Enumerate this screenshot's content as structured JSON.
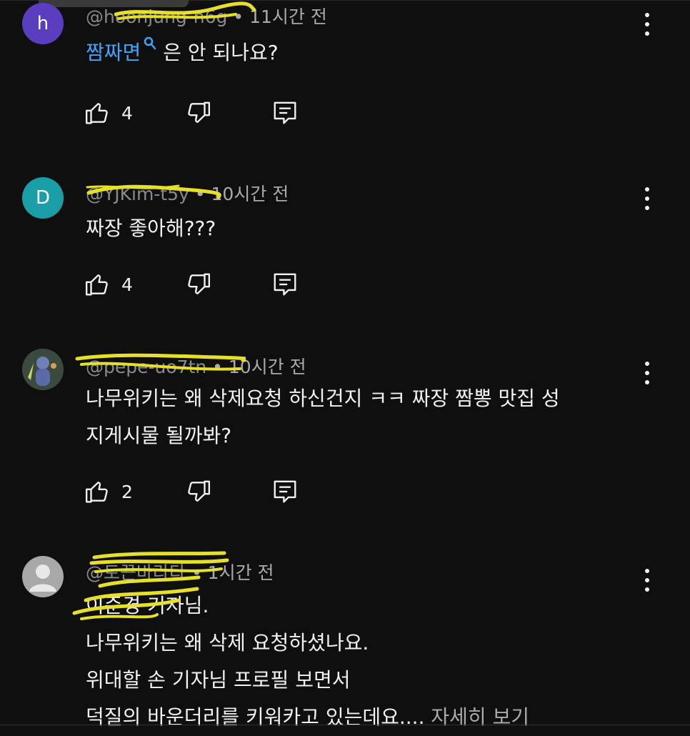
{
  "comments": [
    {
      "avatar_letter": "h",
      "avatar_color": "#5b3dc0",
      "handle": "@hoonjung-n6g",
      "time": "11시간 전",
      "link_text": "짬짜면",
      "line1_rest": " 은 안 되나요?",
      "likes": "4"
    },
    {
      "avatar_letter": "D",
      "avatar_color": "#1a9fa8",
      "handle": "@YJKim-t5y",
      "time": "10시간 전",
      "line1": "짜장 좋아해???",
      "likes": "4"
    },
    {
      "handle": "@pepe-uo7tn",
      "time": "10시간 전",
      "line1": "나무위키는 왜 삭제요청 하신건지 ㅋㅋ 짜장 짬뽕 맛집 성",
      "line2": "지게시물 될까봐?",
      "likes": "2"
    },
    {
      "handle": "@토끈바라다",
      "time": "1시간 전",
      "line1": "이준경 기자님.",
      "line2": "나무위키는 왜 삭제 요청하셨나요.",
      "line3": "위대할 손 기자님 프로필 보면서",
      "line4": "덕질의 바운더리를 키워카고 있는데요....",
      "more_label": " 자세히 보기"
    }
  ],
  "colors": {
    "background": "#0f0f0f",
    "link": "#3ea6ff",
    "scribble": "#e6e02a",
    "secondary_text": "#aaaaaa"
  },
  "icons": [
    "thumbs-up-icon",
    "thumbs-down-icon",
    "reply-icon",
    "more-vert-icon",
    "search-icon"
  ]
}
